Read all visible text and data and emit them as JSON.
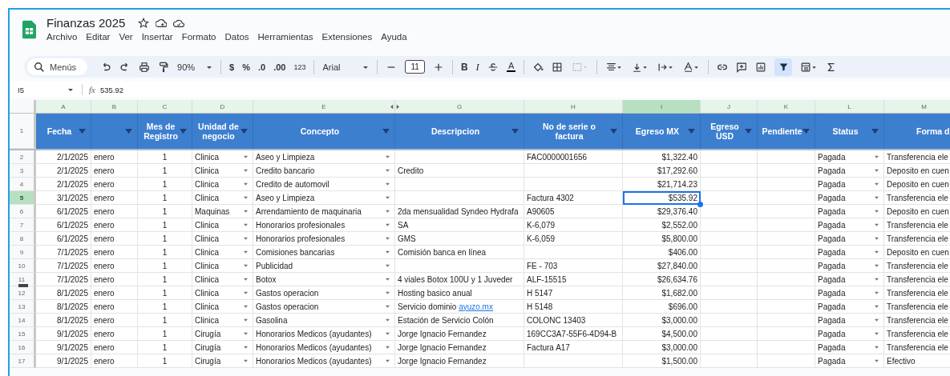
{
  "title": "Finanzas 2025",
  "menu": [
    "Archivo",
    "Editar",
    "Ver",
    "Insertar",
    "Formato",
    "Datos",
    "Herramientas",
    "Extensiones",
    "Ayuda"
  ],
  "toolbar": {
    "search_placeholder": "Menús",
    "zoom": "90%",
    "currency": "$",
    "percent": "%",
    "decrease_decimals": ".0",
    "increase_decimals": ".00",
    "number_format": "123",
    "font": "Arial",
    "font_size": "11",
    "bold": "B",
    "italic": "I",
    "text_color": "A",
    "filter_on": true
  },
  "formula_bar": {
    "cell": "I5",
    "fx": "fx",
    "value": "535.92"
  },
  "columns": [
    {
      "letter": "A",
      "selected": false
    },
    {
      "letter": "B",
      "selected": false
    },
    {
      "letter": "C",
      "selected": false
    },
    {
      "letter": "D",
      "selected": false
    },
    {
      "letter": "E",
      "selected": false
    },
    {
      "letter": "G",
      "selected": false
    },
    {
      "letter": "H",
      "selected": false
    },
    {
      "letter": "I",
      "selected": true
    },
    {
      "letter": "J",
      "selected": false
    },
    {
      "letter": "K",
      "selected": false
    },
    {
      "letter": "L",
      "selected": false
    },
    {
      "letter": "M",
      "selected": false
    }
  ],
  "header_row": "1",
  "headers": [
    {
      "label": "Fecha",
      "filter": true
    },
    {
      "filter": true
    },
    {
      "label": "Mes de Registro",
      "filter": true
    },
    {
      "label": "Unidad de negocio",
      "filter": true
    },
    {
      "label": "Concepto",
      "filter": true
    },
    {
      "label": "Descripcion",
      "filter": true
    },
    {
      "label": "No de serie o factura",
      "filter": true
    },
    {
      "label": "Egreso MX",
      "filter": true
    },
    {
      "label": "Egreso USD",
      "filter": true
    },
    {
      "label": "Pendiente",
      "filter": true
    },
    {
      "label": "Status",
      "filter": true
    },
    {
      "label": "Forma d"
    }
  ],
  "rows": [
    {
      "num": "2",
      "selected": false,
      "fecha": "2/1/2025",
      "mes": "enero",
      "registro": "1",
      "unidad": "Clinica",
      "concepto": "Aseo y Limpieza",
      "factura": "FAC0000001656",
      "egreso_mx": "$1,322.40",
      "status": "Pagada",
      "forma": "Transferencia ele"
    },
    {
      "num": "3",
      "selected": false,
      "fecha": "2/1/2025",
      "mes": "enero",
      "registro": "1",
      "unidad": "Clinica",
      "concepto": "Credito bancario",
      "descripcion": "Credito",
      "egreso_mx": "$17,292.60",
      "status": "Pagada",
      "forma": "Deposito en cuen"
    },
    {
      "num": "4",
      "selected": false,
      "fecha": "2/1/2025",
      "mes": "enero",
      "registro": "1",
      "unidad": "Clinica",
      "concepto": "Credito de automovil",
      "egreso_mx": "$21,714.23",
      "status": "Pagada",
      "forma": "Deposito en cuen"
    },
    {
      "num": "5",
      "selected": true,
      "fecha": "3/1/2025",
      "mes": "enero",
      "registro": "1",
      "unidad": "Clinica",
      "concepto": "Aseo y Limpieza",
      "factura": "Factura 4302",
      "egreso_mx": "$535.92",
      "status": "Pagada",
      "forma": "Transferencia ele"
    },
    {
      "num": "6",
      "selected": false,
      "fecha": "6/1/2025",
      "mes": "enero",
      "registro": "1",
      "unidad": "Maquinas",
      "concepto": "Arrendamiento de maquinaria",
      "descripcion": "2da mensualidad Syndeo Hydrafa",
      "factura": "A90605",
      "egreso_mx": "$29,376.40",
      "status": "Pagada",
      "forma": "Deposito en cuen"
    },
    {
      "num": "7",
      "selected": false,
      "fecha": "6/1/2025",
      "mes": "enero",
      "registro": "1",
      "unidad": "Clinica",
      "concepto": "Honorarios profesionales",
      "descripcion": "SA",
      "factura": "K-6,079",
      "egreso_mx": "$2,552.00",
      "status": "Pagada",
      "forma": "Transferencia ele"
    },
    {
      "num": "8",
      "selected": false,
      "fecha": "6/1/2025",
      "mes": "enero",
      "registro": "1",
      "unidad": "Clinica",
      "concepto": "Honorarios profesionales",
      "descripcion": "GMS",
      "factura": "K-6,059",
      "egreso_mx": "$5,800.00",
      "status": "Pagada",
      "forma": "Transferencia ele"
    },
    {
      "num": "9",
      "selected": false,
      "fecha": "7/1/2025",
      "mes": "enero",
      "registro": "1",
      "unidad": "Clinica",
      "concepto": "Comisiones bancarias",
      "descripcion": "Comisión banca en línea",
      "egreso_mx": "$406.00",
      "status": "Pagada",
      "forma": "Deposito en cuen"
    },
    {
      "num": "10",
      "selected": false,
      "fecha": "7/1/2025",
      "mes": "enero",
      "registro": "1",
      "unidad": "Clinica",
      "concepto": "Publicidad",
      "factura": "FE - 703",
      "egreso_mx": "$27,840.00",
      "status": "Pagada",
      "forma": "Transferencia ele"
    },
    {
      "num": "11",
      "selected": false,
      "fecha": "7/1/2025",
      "mes": "enero",
      "registro": "1",
      "unidad": "Clinica",
      "concepto": "Botox",
      "descripcion": "4 viales Botox 100U y 1 Juveder",
      "factura": "ALF-15515",
      "egreso_mx": "$26,634.76",
      "status": "Pagada",
      "forma": "Transferencia ele"
    },
    {
      "num": "12",
      "selected": false,
      "fecha": "8/1/2025",
      "mes": "enero",
      "registro": "1",
      "unidad": "Clinica",
      "concepto": "Gastos operacion",
      "descripcion": "Hosting basico anual",
      "factura": "H 5147",
      "egreso_mx": "$1,682.00",
      "status": "Pagada",
      "forma": "Transferencia ele"
    },
    {
      "num": "13",
      "selected": false,
      "fecha": "8/1/2025",
      "mes": "enero",
      "registro": "1",
      "unidad": "Clinica",
      "concepto": "Gastos operacion",
      "descripcion": "Servicio dominio",
      "descripcion_link": "ayuzo.mx",
      "factura": "H 5148",
      "egreso_mx": "$696.00",
      "status": "Pagada",
      "forma": "Transferencia ele"
    },
    {
      "num": "14",
      "selected": false,
      "fecha": "8/1/2025",
      "mes": "enero",
      "registro": "1",
      "unidad": "Clinica",
      "concepto": "Gasolina",
      "descripcion": "Estación de Servicio Colón",
      "factura": "COLONC 13403",
      "egreso_mx": "$3,000.00",
      "status": "Pagada",
      "forma": "Transferencia ele"
    },
    {
      "num": "15",
      "selected": false,
      "fecha": "9/1/2025",
      "mes": "enero",
      "registro": "1",
      "unidad": "Cirugía",
      "concepto": "Honorarios Medicos (ayudantes)",
      "descripcion": "Jorge Ignacio Fernandez",
      "factura": "169CC3A7-55F6-4D94-B",
      "egreso_mx": "$4,500.00",
      "status": "Pagada",
      "forma": "Transferencia ele"
    },
    {
      "num": "16",
      "selected": false,
      "fecha": "9/1/2025",
      "mes": "enero",
      "registro": "1",
      "unidad": "Cirugía",
      "concepto": "Honorarios Medicos (ayudantes)",
      "descripcion": "Jorge Ignacio Fernandez",
      "factura": "Factura A17",
      "egreso_mx": "$3,000.00",
      "status": "Pagada",
      "forma": "Transferencia ele"
    },
    {
      "num": "17",
      "selected": false,
      "fecha": "9/1/2025",
      "mes": "enero",
      "registro": "1",
      "unidad": "Cirugía",
      "concepto": "Honorarios Medicos (ayudantes)",
      "descripcion": "Jorge Ignacio Fernandez",
      "egreso_mx": "$1,500.00",
      "status": "Pagada",
      "forma": "Efectivo"
    }
  ]
}
